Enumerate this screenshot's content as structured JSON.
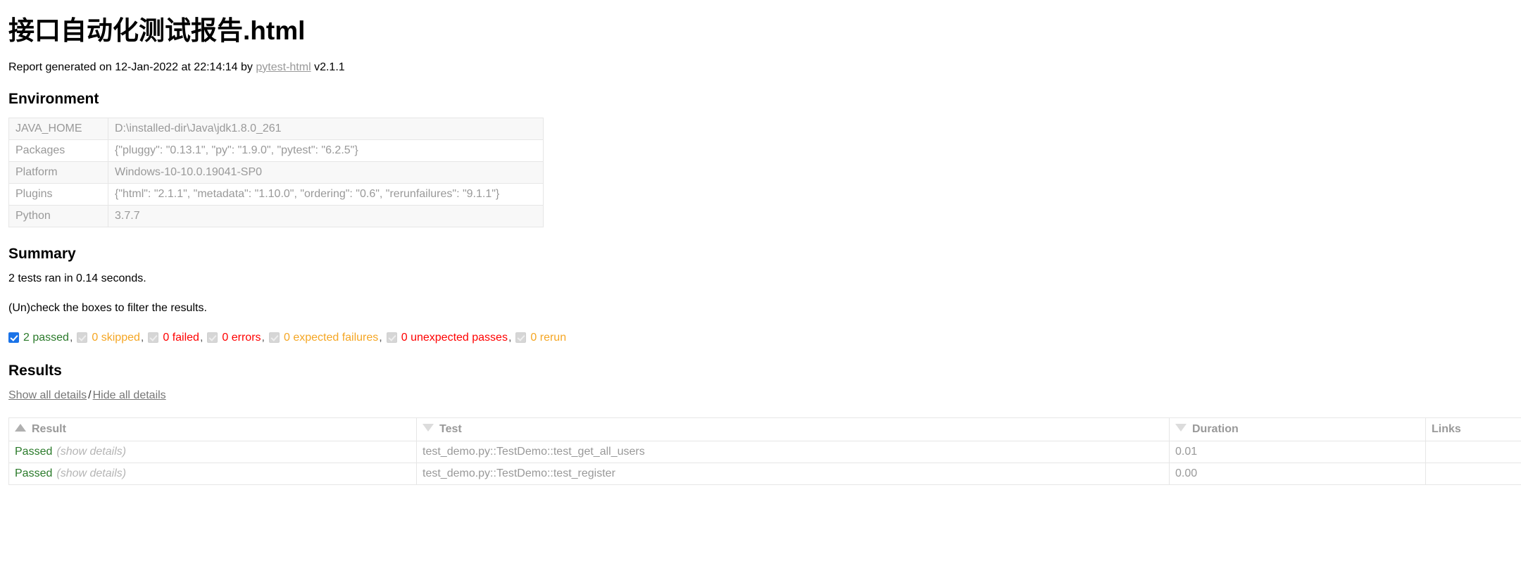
{
  "report": {
    "title": "接口自动化测试报告.html",
    "generated_prefix": "Report generated on ",
    "generated_date": "12-Jan-2022",
    "generated_mid": " at ",
    "generated_time": "22:14:14",
    "generated_by": " by ",
    "generator_link": "pytest-html",
    "generator_version": " v2.1.1"
  },
  "environment": {
    "heading": "Environment",
    "rows": [
      {
        "key": "JAVA_HOME",
        "value": "D:\\installed-dir\\Java\\jdk1.8.0_261"
      },
      {
        "key": "Packages",
        "value": "{\"pluggy\": \"0.13.1\", \"py\": \"1.9.0\", \"pytest\": \"6.2.5\"}"
      },
      {
        "key": "Platform",
        "value": "Windows-10-10.0.19041-SP0"
      },
      {
        "key": "Plugins",
        "value": "{\"html\": \"2.1.1\", \"metadata\": \"1.10.0\", \"ordering\": \"0.6\", \"rerunfailures\": \"9.1.1\"}"
      },
      {
        "key": "Python",
        "value": "3.7.7"
      }
    ]
  },
  "summary": {
    "heading": "Summary",
    "run_line": "2 tests ran in 0.14 seconds.",
    "filter_hint": "(Un)check the boxes to filter the results.",
    "filters": [
      {
        "label": "2 passed",
        "checked": true,
        "color": "#2a7a2a",
        "separator": ","
      },
      {
        "label": "0 skipped",
        "checked": false,
        "color": "#f5a623",
        "separator": ","
      },
      {
        "label": "0 failed",
        "checked": false,
        "color": "#ff0000",
        "separator": ","
      },
      {
        "label": "0 errors",
        "checked": false,
        "color": "#ff0000",
        "separator": ","
      },
      {
        "label": "0 expected failures",
        "checked": false,
        "color": "#f5a623",
        "separator": ","
      },
      {
        "label": "0 unexpected passes",
        "checked": false,
        "color": "#ff0000",
        "separator": ","
      },
      {
        "label": "0 rerun",
        "checked": false,
        "color": "#f5a623",
        "separator": ""
      }
    ]
  },
  "results": {
    "heading": "Results",
    "show_all": "Show all details",
    "separator": "/",
    "hide_all": "Hide all details",
    "columns": [
      {
        "label": "Result",
        "sort": "up"
      },
      {
        "label": "Test",
        "sort": "down"
      },
      {
        "label": "Duration",
        "sort": "down"
      },
      {
        "label": "Links",
        "sort": "none"
      }
    ],
    "rows": [
      {
        "result": "Passed",
        "details_label": "(show details)",
        "test": "test_demo.py::TestDemo::test_get_all_users",
        "duration": "0.01",
        "links": ""
      },
      {
        "result": "Passed",
        "details_label": "(show details)",
        "test": "test_demo.py::TestDemo::test_register",
        "duration": "0.00",
        "links": ""
      }
    ]
  }
}
